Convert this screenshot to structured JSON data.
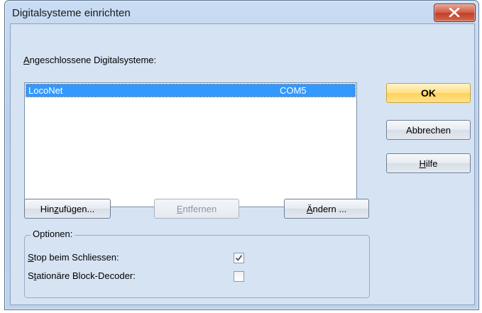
{
  "window": {
    "title": "Digitalsysteme einrichten"
  },
  "systems": {
    "label_prefix": "",
    "label_underlined": "A",
    "label_rest": "ngeschlossene Digitalsysteme:",
    "rows": [
      {
        "name": "LocoNet",
        "port": "COM5",
        "selected": true
      }
    ]
  },
  "buttons": {
    "ok": "OK",
    "cancel": "Abbrechen",
    "help_prefix": "",
    "help_underlined": "H",
    "help_rest": "ilfe",
    "add_prefix": "Hin",
    "add_underlined": "z",
    "add_rest": "ufügen...",
    "remove_prefix": "",
    "remove_underlined": "E",
    "remove_rest": "ntfernen",
    "change_prefix": "",
    "change_underlined": "Ä",
    "change_rest": "ndern ..."
  },
  "options": {
    "group_label": "Optionen:",
    "stop_prefix": "",
    "stop_underlined": "S",
    "stop_rest": "top beim Schliessen:",
    "stop_checked": true,
    "stationary_prefix": "S",
    "stationary_underlined": "t",
    "stationary_rest": "ationäre Block-Decoder:",
    "stationary_checked": false
  }
}
